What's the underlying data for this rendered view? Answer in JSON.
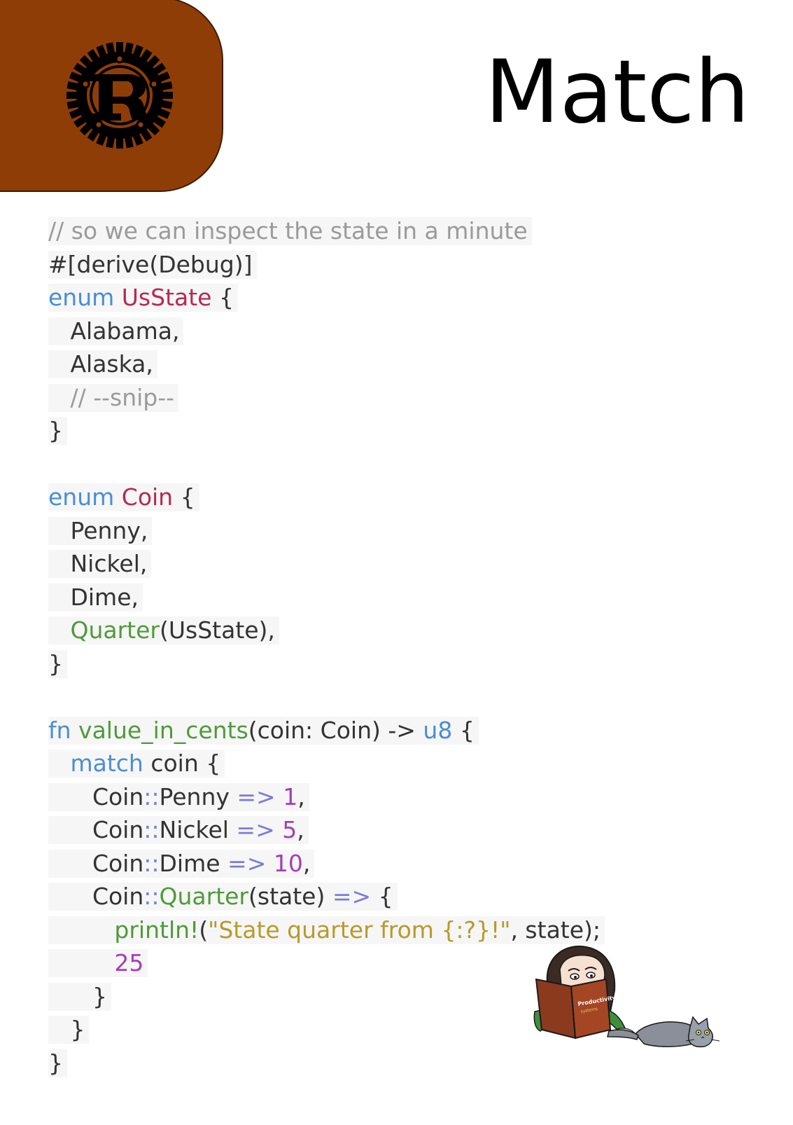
{
  "header": {
    "title": "Match",
    "logo_icon": "rust-logo-icon",
    "logo_color": "#8f3d07"
  },
  "code": {
    "lines": [
      [
        {
          "t": "// so we can inspect the state in a minute",
          "c": "com"
        }
      ],
      [
        {
          "t": "#[derive(Debug)]",
          "c": "plain"
        }
      ],
      [
        {
          "t": "enum",
          "c": "kw"
        },
        {
          "t": " ",
          "c": "plain"
        },
        {
          "t": "UsState",
          "c": "type"
        },
        {
          "t": " {",
          "c": "plain"
        }
      ],
      [
        {
          "t": "   Alabama,",
          "c": "plain"
        }
      ],
      [
        {
          "t": "   Alaska,",
          "c": "plain"
        }
      ],
      [
        {
          "t": "   // --snip--",
          "c": "com"
        }
      ],
      [
        {
          "t": "}",
          "c": "plain"
        }
      ],
      [],
      [
        {
          "t": "enum",
          "c": "kw"
        },
        {
          "t": " ",
          "c": "plain"
        },
        {
          "t": "Coin",
          "c": "type"
        },
        {
          "t": " {",
          "c": "plain"
        }
      ],
      [
        {
          "t": "   Penny,",
          "c": "plain"
        }
      ],
      [
        {
          "t": "   Nickel,",
          "c": "plain"
        }
      ],
      [
        {
          "t": "   Dime,",
          "c": "plain"
        }
      ],
      [
        {
          "t": "   ",
          "c": "plain"
        },
        {
          "t": "Quarter",
          "c": "fn"
        },
        {
          "t": "(UsState),",
          "c": "plain"
        }
      ],
      [
        {
          "t": "}",
          "c": "plain"
        }
      ],
      [],
      [
        {
          "t": "fn",
          "c": "kw"
        },
        {
          "t": " ",
          "c": "plain"
        },
        {
          "t": "value_in_cents",
          "c": "fn"
        },
        {
          "t": "(coin: Coin) -> ",
          "c": "plain"
        },
        {
          "t": "u8",
          "c": "kw"
        },
        {
          "t": " {",
          "c": "plain"
        }
      ],
      [
        {
          "t": "   ",
          "c": "plain"
        },
        {
          "t": "match",
          "c": "kw"
        },
        {
          "t": " coin {",
          "c": "plain"
        }
      ],
      [
        {
          "t": "      Coin",
          "c": "plain"
        },
        {
          "t": "::",
          "c": "op"
        },
        {
          "t": "Penny ",
          "c": "plain"
        },
        {
          "t": "=>",
          "c": "op"
        },
        {
          "t": " ",
          "c": "plain"
        },
        {
          "t": "1",
          "c": "num"
        },
        {
          "t": ",",
          "c": "plain"
        }
      ],
      [
        {
          "t": "      Coin",
          "c": "plain"
        },
        {
          "t": "::",
          "c": "op"
        },
        {
          "t": "Nickel ",
          "c": "plain"
        },
        {
          "t": "=>",
          "c": "op"
        },
        {
          "t": " ",
          "c": "plain"
        },
        {
          "t": "5",
          "c": "num"
        },
        {
          "t": ",",
          "c": "plain"
        }
      ],
      [
        {
          "t": "      Coin",
          "c": "plain"
        },
        {
          "t": "::",
          "c": "op"
        },
        {
          "t": "Dime ",
          "c": "plain"
        },
        {
          "t": "=>",
          "c": "op"
        },
        {
          "t": " ",
          "c": "plain"
        },
        {
          "t": "10",
          "c": "num"
        },
        {
          "t": ",",
          "c": "plain"
        }
      ],
      [
        {
          "t": "      Coin",
          "c": "plain"
        },
        {
          "t": "::",
          "c": "op"
        },
        {
          "t": "Quarter",
          "c": "fn"
        },
        {
          "t": "(state) ",
          "c": "plain"
        },
        {
          "t": "=>",
          "c": "op"
        },
        {
          "t": " {",
          "c": "plain"
        }
      ],
      [
        {
          "t": "         ",
          "c": "plain"
        },
        {
          "t": "println!",
          "c": "fn"
        },
        {
          "t": "(",
          "c": "plain"
        },
        {
          "t": "\"State quarter from {:?}!\"",
          "c": "str"
        },
        {
          "t": ", state);",
          "c": "plain"
        }
      ],
      [
        {
          "t": "         ",
          "c": "plain"
        },
        {
          "t": "25",
          "c": "num"
        }
      ],
      [
        {
          "t": "      }",
          "c": "plain"
        }
      ],
      [
        {
          "t": "   }",
          "c": "plain"
        }
      ],
      [
        {
          "t": "}",
          "c": "plain"
        }
      ]
    ]
  },
  "illustration": {
    "icon": "reading-girl-with-cat-icon",
    "book_title": "Productivity"
  }
}
